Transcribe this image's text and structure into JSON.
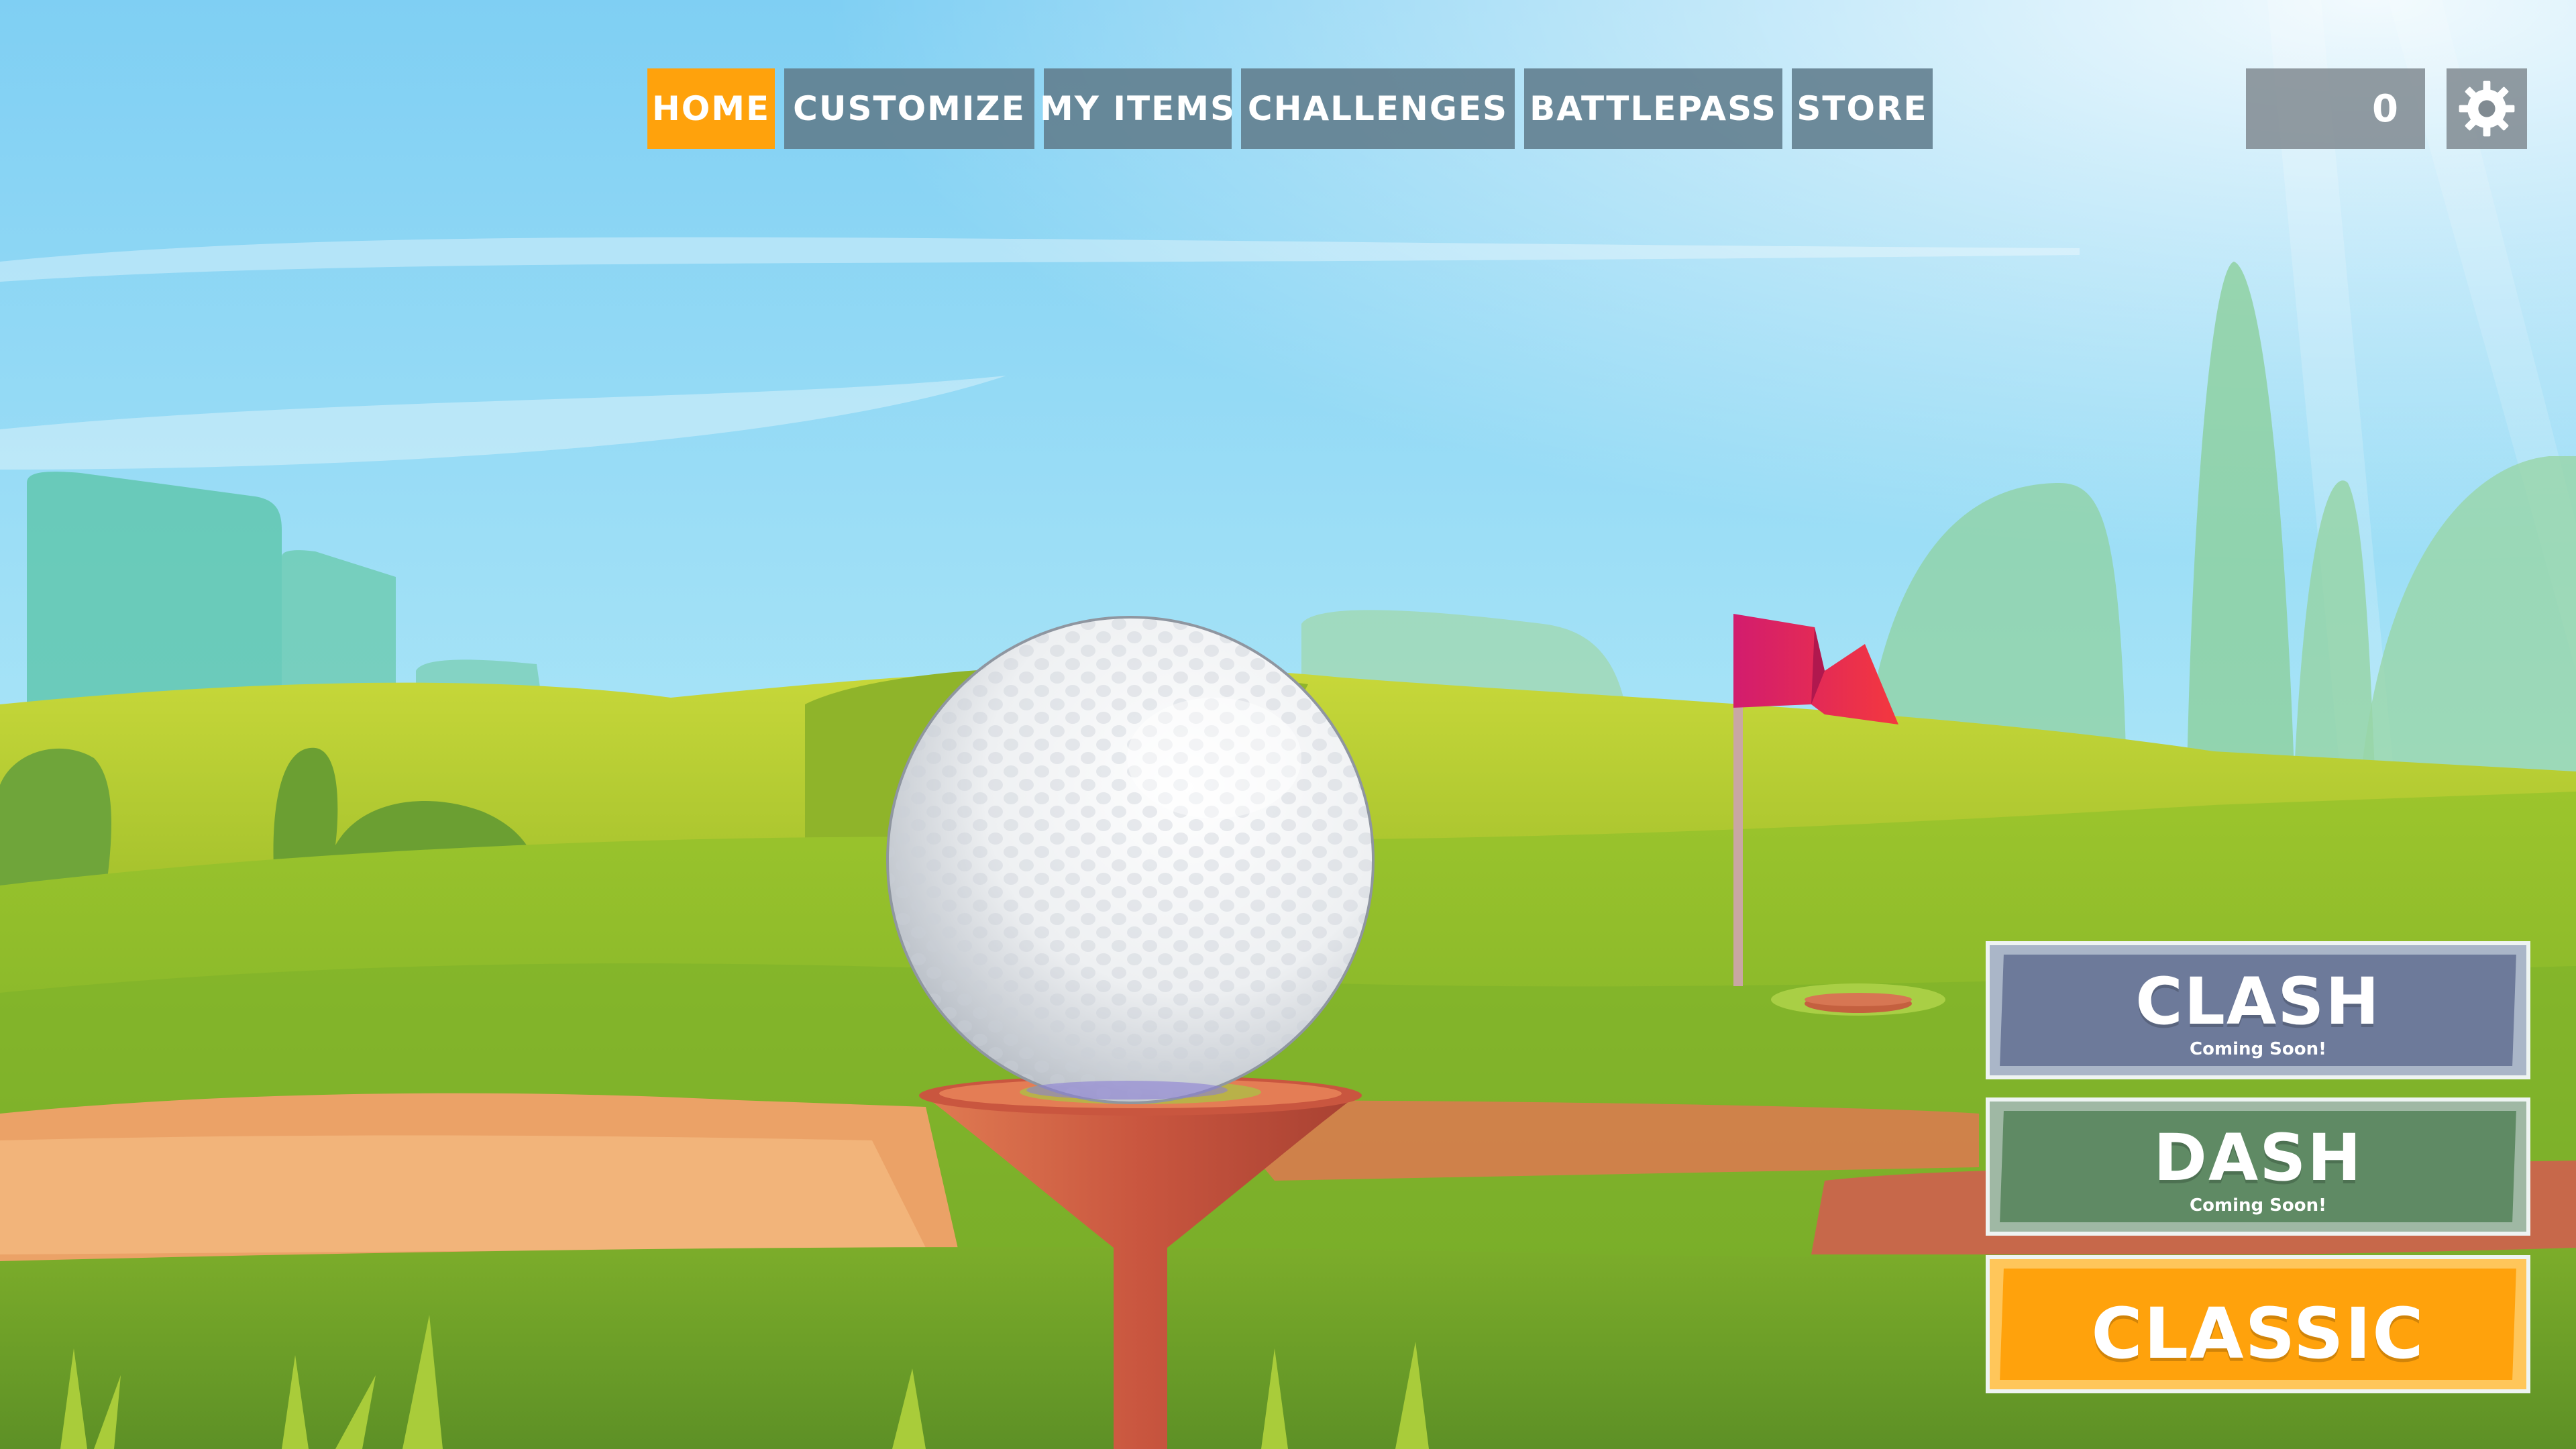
{
  "nav": {
    "tabs": [
      {
        "label": "HOME",
        "active": true
      },
      {
        "label": "CUSTOMIZE",
        "active": false
      },
      {
        "label": "MY ITEMS",
        "active": false
      },
      {
        "label": "CHALLENGES",
        "active": false
      },
      {
        "label": "BATTLEPASS",
        "active": false
      },
      {
        "label": "STORE",
        "active": false
      }
    ]
  },
  "currency": {
    "value": "0"
  },
  "settings": {
    "icon": "gear-icon"
  },
  "modes": {
    "clash": {
      "title": "CLASH",
      "subtitle": "Coming Soon!",
      "enabled": false
    },
    "dash": {
      "title": "DASH",
      "subtitle": "Coming Soon!",
      "enabled": false
    },
    "classic": {
      "title": "CLASSIC",
      "enabled": true
    }
  },
  "colors": {
    "active_tab": "#ffa20c",
    "inactive_tab": "#607c8c",
    "clash_button": "#6d7a9a",
    "dash_button": "#5f8a64",
    "classic_button": "#ffa20c",
    "flag": "#e8265a",
    "fairway": "#8dbb2a"
  }
}
